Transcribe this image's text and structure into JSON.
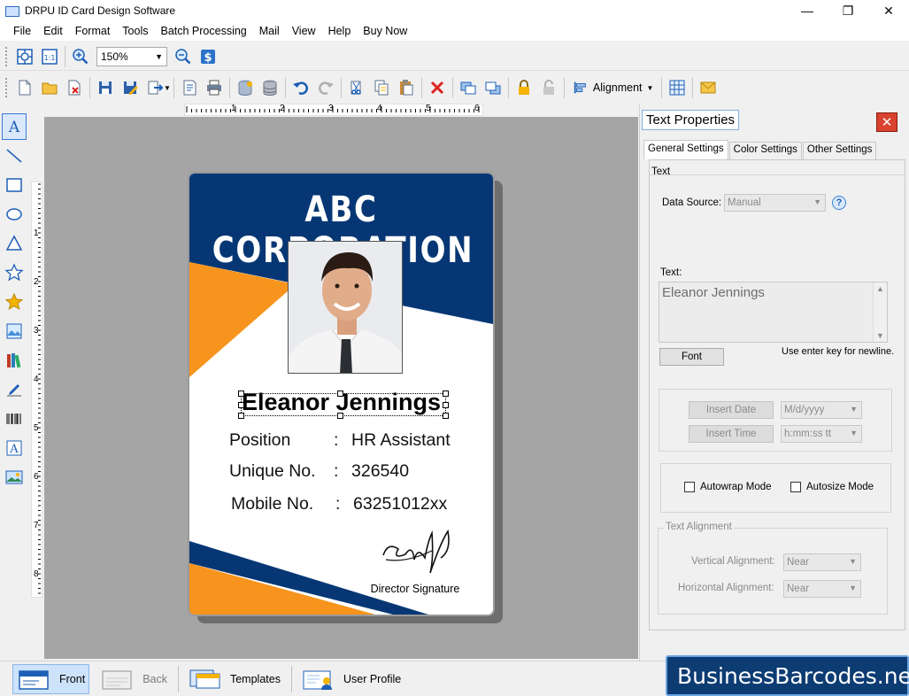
{
  "window": {
    "title": "DRPU ID Card Design Software",
    "minimize": "—",
    "restore": "❐",
    "close": "✕"
  },
  "menu": [
    "File",
    "Edit",
    "Format",
    "Tools",
    "Batch Processing",
    "Mail",
    "View",
    "Help",
    "Buy Now"
  ],
  "toolbar": {
    "zoom_value": "150%",
    "alignment_label": "Alignment"
  },
  "rulers": {
    "horizontal": [
      "1",
      "2",
      "3",
      "4",
      "5",
      "6"
    ],
    "vertical": [
      "1",
      "2",
      "3",
      "4",
      "5",
      "6",
      "7",
      "8"
    ]
  },
  "card": {
    "company": "ABC CORPORATION",
    "name": "Eleanor Jennings",
    "rows": [
      {
        "label": "Position",
        "colon": ":",
        "value": "HR Assistant"
      },
      {
        "label": "Unique No.",
        "colon": ":",
        "value": "326540"
      },
      {
        "label": "Mobile No.",
        "colon": ":",
        "value": "63251012xx"
      }
    ],
    "signature_label": "Director Signature",
    "colors": {
      "navy": "#063774",
      "orange": "#f7941d"
    }
  },
  "panel": {
    "title": "Text Properties",
    "tabs": [
      "General Settings",
      "Color Settings",
      "Other Settings"
    ],
    "text_group": "Text",
    "data_source_label": "Data Source:",
    "data_source_value": "Manual",
    "help_glyph": "?",
    "text_label": "Text:",
    "text_value": "Eleanor Jennings",
    "font_button": "Font",
    "newline_hint": "Use enter key for newline.",
    "insert_date": "Insert Date",
    "date_format": "M/d/yyyy",
    "insert_time": "Insert Time",
    "time_format": "h:mm:ss tt",
    "autowrap": "Autowrap Mode",
    "autosize": "Autosize Mode",
    "alignment_group": "Text Alignment",
    "vertical_label": "Vertical Alignment:",
    "vertical_value": "Near",
    "horizontal_label": "Horizontal  Alignment:",
    "horizontal_value": "Near"
  },
  "bottom": {
    "front": "Front",
    "back": "Back",
    "templates": "Templates",
    "user_profile": "User Profile",
    "brand": "BusinessBarcodes.net"
  }
}
